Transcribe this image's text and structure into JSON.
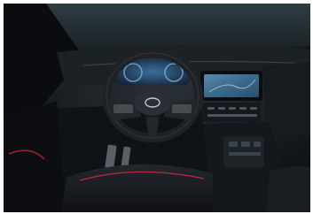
{
  "photo": {
    "subject": "car-interior",
    "dashboard_brand_emblem": "steering-wheel-logo",
    "colors": {
      "background": "#0d1014",
      "dashboard": "#1a1e23",
      "seat": "#15181c",
      "seat_stitch": "#b3283a",
      "screen": "#3e6e8e",
      "instrument_cluster": "#2a4a66",
      "window": "#2c3a3f"
    }
  }
}
